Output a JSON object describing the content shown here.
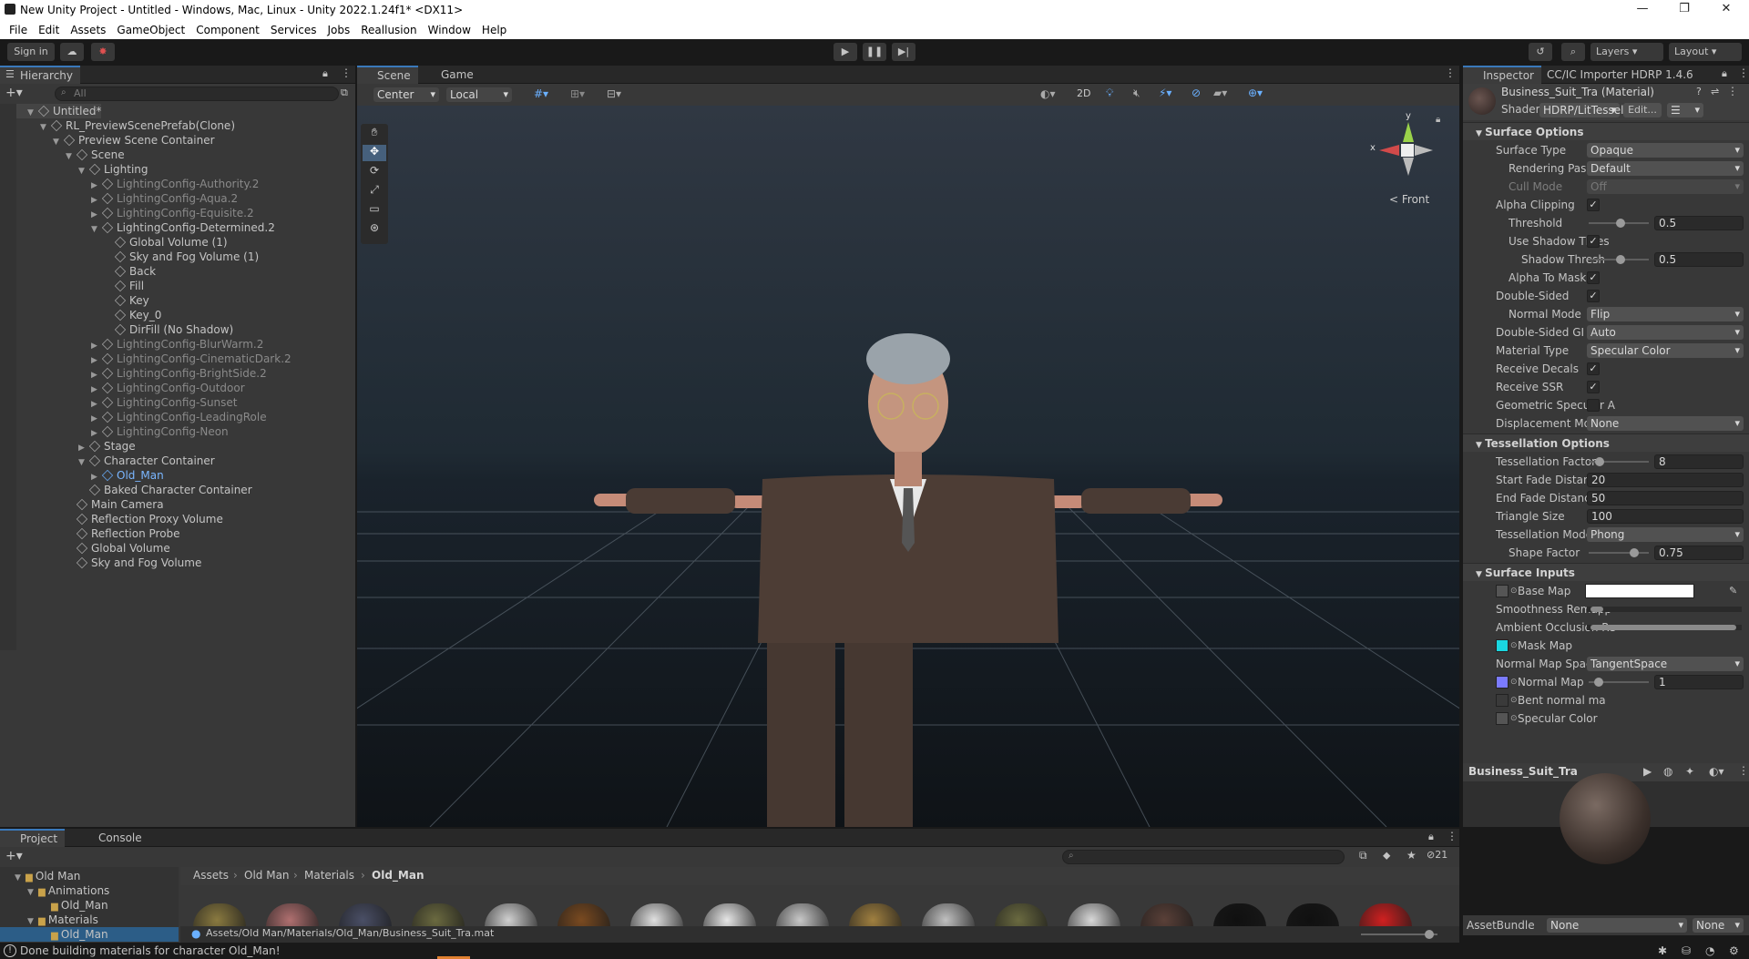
{
  "window": {
    "title": "New Unity Project - Untitled - Windows, Mac, Linux - Unity 2022.1.24f1* <DX11>"
  },
  "menu": [
    "File",
    "Edit",
    "Assets",
    "GameObject",
    "Component",
    "Services",
    "Jobs",
    "Reallusion",
    "Window",
    "Help"
  ],
  "toolbar": {
    "sign_in": "Sign in",
    "layers": "Layers",
    "layout": "Layout"
  },
  "hierarchy": {
    "tab": "Hierarchy",
    "search_placeholder": "All",
    "rows": [
      {
        "label": "Untitled*",
        "depth": 0,
        "state": "normal"
      },
      {
        "label": "RL_PreviewScenePrefab(Clone)",
        "depth": 1,
        "state": "normal"
      },
      {
        "label": "Preview Scene Container",
        "depth": 2,
        "state": "normal"
      },
      {
        "label": "Scene",
        "depth": 3,
        "state": "normal"
      },
      {
        "label": "Lighting",
        "depth": 4,
        "state": "normal"
      },
      {
        "label": "LightingConfig-Authority.2",
        "depth": 5,
        "state": "dim"
      },
      {
        "label": "LightingConfig-Aqua.2",
        "depth": 5,
        "state": "dim"
      },
      {
        "label": "LightingConfig-Equisite.2",
        "depth": 5,
        "state": "dim"
      },
      {
        "label": "LightingConfig-Determined.2",
        "depth": 5,
        "state": "normal"
      },
      {
        "label": "Global Volume (1)",
        "depth": 6,
        "state": "normal"
      },
      {
        "label": "Sky and Fog Volume (1)",
        "depth": 6,
        "state": "normal"
      },
      {
        "label": "Back",
        "depth": 6,
        "state": "normal"
      },
      {
        "label": "Fill",
        "depth": 6,
        "state": "normal"
      },
      {
        "label": "Key",
        "depth": 6,
        "state": "normal"
      },
      {
        "label": "Key_0",
        "depth": 6,
        "state": "normal"
      },
      {
        "label": "DirFill (No Shadow)",
        "depth": 6,
        "state": "normal"
      },
      {
        "label": "LightingConfig-BlurWarm.2",
        "depth": 5,
        "state": "dim"
      },
      {
        "label": "LightingConfig-CinematicDark.2",
        "depth": 5,
        "state": "dim"
      },
      {
        "label": "LightingConfig-BrightSide.2",
        "depth": 5,
        "state": "dim"
      },
      {
        "label": "LightingConfig-Outdoor",
        "depth": 5,
        "state": "dim"
      },
      {
        "label": "LightingConfig-Sunset",
        "depth": 5,
        "state": "dim"
      },
      {
        "label": "LightingConfig-LeadingRole",
        "depth": 5,
        "state": "dim"
      },
      {
        "label": "LightingConfig-Neon",
        "depth": 5,
        "state": "dim"
      },
      {
        "label": "Stage",
        "depth": 4,
        "state": "normal"
      },
      {
        "label": "Character Container",
        "depth": 4,
        "state": "normal"
      },
      {
        "label": "Old_Man",
        "depth": 5,
        "state": "selected"
      },
      {
        "label": "Baked Character Container",
        "depth": 4,
        "state": "normal"
      },
      {
        "label": "Main Camera",
        "depth": 3,
        "state": "normal"
      },
      {
        "label": "Reflection Proxy Volume",
        "depth": 3,
        "state": "normal"
      },
      {
        "label": "Reflection Probe",
        "depth": 3,
        "state": "normal"
      },
      {
        "label": "Global Volume",
        "depth": 3,
        "state": "normal"
      },
      {
        "label": "Sky and Fog Volume",
        "depth": 3,
        "state": "normal"
      }
    ]
  },
  "scene": {
    "tabs": [
      "Scene",
      "Game"
    ],
    "pivot": "Center",
    "space": "Local",
    "mode_2d": "2D",
    "gizmo_view": "Front",
    "gizmo_x": "x",
    "gizmo_y": "y"
  },
  "inspector": {
    "tabs": [
      "Inspector",
      "CC/IC Importer HDRP 1.4.6"
    ],
    "material_name": "Business_Suit_Tra (Material)",
    "shader_label": "Shader",
    "shader_value": "HDRP/LitTessel",
    "edit_label": "Edit...",
    "sections": {
      "surface_options": "Surface Options",
      "tessellation_options": "Tessellation Options",
      "surface_inputs": "Surface Inputs"
    },
    "surface_options": [
      {
        "label": "Surface Type",
        "kind": "dd",
        "value": "Opaque",
        "indent": 0
      },
      {
        "label": "Rendering Pass",
        "kind": "dd",
        "value": "Default",
        "indent": 1
      },
      {
        "label": "Cull Mode",
        "kind": "dd",
        "value": "Off",
        "indent": 1,
        "dim": true
      },
      {
        "label": "Alpha Clipping",
        "kind": "chk",
        "value": "✓",
        "indent": 0
      },
      {
        "label": "Threshold",
        "kind": "slider",
        "value": "0.5",
        "indent": 1,
        "pos": 0.5
      },
      {
        "label": "Use Shadow Thres",
        "kind": "chk",
        "value": "✓",
        "indent": 1
      },
      {
        "label": "Shadow Thresh",
        "kind": "slider",
        "value": "0.5",
        "indent": 2,
        "pos": 0.5
      },
      {
        "label": "Alpha To Mask",
        "kind": "chk",
        "value": "✓",
        "indent": 1
      },
      {
        "label": "Double-Sided",
        "kind": "chk",
        "value": "✓",
        "indent": 0
      },
      {
        "label": "Normal Mode",
        "kind": "dd",
        "value": "Flip",
        "indent": 1
      },
      {
        "label": "Double-Sided GI",
        "kind": "dd",
        "value": "Auto",
        "indent": 0
      },
      {
        "label": "Material Type",
        "kind": "dd",
        "value": "Specular Color",
        "indent": 0
      },
      {
        "label": "Receive Decals",
        "kind": "chk",
        "value": "✓",
        "indent": 0
      },
      {
        "label": "Receive SSR",
        "kind": "chk",
        "value": "✓",
        "indent": 0
      },
      {
        "label": "Geometric Specular A",
        "kind": "chk",
        "value": "",
        "indent": 0
      },
      {
        "label": "Displacement Mode",
        "kind": "dd",
        "value": "None",
        "indent": 0
      }
    ],
    "tessellation": [
      {
        "label": "Tessellation Factor",
        "kind": "slider",
        "value": "8",
        "indent": 0,
        "pos": 0.12
      },
      {
        "label": "Start Fade Distance",
        "kind": "fld",
        "value": "20",
        "indent": 0
      },
      {
        "label": "End Fade Distance",
        "kind": "fld",
        "value": "50",
        "indent": 0
      },
      {
        "label": "Triangle Size",
        "kind": "fld",
        "value": "100",
        "indent": 0
      },
      {
        "label": "Tessellation Mode",
        "kind": "dd",
        "value": "Phong",
        "indent": 0
      },
      {
        "label": "Shape Factor",
        "kind": "slider",
        "value": "0.75",
        "indent": 1,
        "pos": 0.75
      }
    ],
    "surface_inputs": [
      {
        "label": "Base Map",
        "kind": "tex",
        "swatch": "#555555",
        "value": ""
      },
      {
        "label": "Smoothness Remapp",
        "kind": "range",
        "value": ""
      },
      {
        "label": "Ambient Occlusion Re",
        "kind": "range",
        "value": ""
      },
      {
        "label": "Mask Map",
        "kind": "tex",
        "swatch": "#1ad7e0",
        "value": ""
      },
      {
        "label": "Normal Map Space",
        "kind": "dd",
        "value": "TangentSpace"
      },
      {
        "label": "Normal Map",
        "kind": "tex",
        "swatch": "#7b7bff",
        "value": "1"
      },
      {
        "label": "Bent normal ma",
        "kind": "tex",
        "swatch": "",
        "value": ""
      },
      {
        "label": "Specular Color",
        "kind": "tex",
        "swatch": "#555555",
        "value": ""
      }
    ],
    "preview_title": "Business_Suit_Tra",
    "asset_bundle_label": "AssetBundle",
    "asset_bundle_value": "None",
    "asset_variant": "None"
  },
  "project": {
    "tabs": [
      "Project",
      "Console"
    ],
    "tree": [
      {
        "label": "Old Man",
        "depth": 0
      },
      {
        "label": "Animations",
        "depth": 1
      },
      {
        "label": "Old_Man",
        "depth": 2
      },
      {
        "label": "Materials",
        "depth": 1
      },
      {
        "label": "Old_Man",
        "depth": 2
      }
    ],
    "breadcrumb": [
      "Assets",
      "Old Man",
      "Materials",
      "Old_Man"
    ],
    "hidden_count": "21",
    "path": "Assets/Old Man/Materials/Old_Man/Business_Suit_Tra.mat",
    "thumb_colors": [
      "#8a7a40",
      "#b07070",
      "#4a4f66",
      "#6b6a40",
      "#d0d0d0",
      "#7a4a20",
      "#e0e0e0",
      "#e6e6e6",
      "#c8c8c8",
      "#a08040",
      "#c0c0c0",
      "#6a6a40",
      "#d8d8d8",
      "#5a4038",
      "#101010",
      "#101010",
      "#d02020"
    ]
  },
  "status": {
    "message": "Done building materials for character Old_Man!"
  }
}
